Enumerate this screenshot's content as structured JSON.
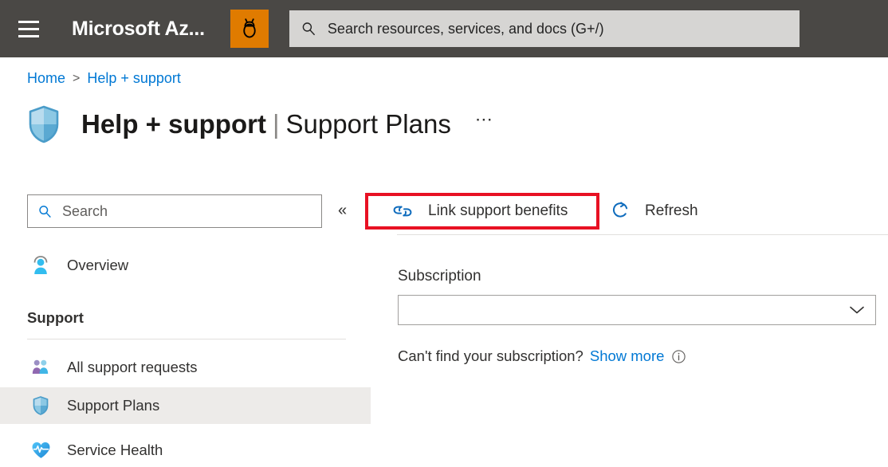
{
  "header": {
    "menu_icon": "hamburger-icon",
    "brand": "Microsoft Az...",
    "bug_icon": "bug-icon",
    "bug_color": "#e07b00",
    "search": {
      "icon": "search-icon",
      "placeholder": "Search resources, services, and docs (G+/)",
      "value": ""
    }
  },
  "breadcrumb": {
    "items": [
      {
        "label": "Home"
      },
      {
        "label": "Help + support"
      }
    ],
    "separator": ">"
  },
  "page": {
    "icon": "shield-icon",
    "title": "Help + support",
    "divider": "|",
    "subtitle": "Support Plans",
    "more_label": "⋯"
  },
  "sidebar": {
    "search": {
      "icon": "search-icon",
      "placeholder": "Search",
      "value": ""
    },
    "collapse_icon": "chevron-double-left-icon",
    "collapse_label": "«",
    "items": [
      {
        "label": "Overview",
        "icon": "support-person-icon",
        "selected": false
      },
      {
        "label": "All support requests",
        "icon": "people-icon",
        "selected": false
      },
      {
        "label": "Support Plans",
        "icon": "shield-icon",
        "selected": true
      },
      {
        "label": "Service Health",
        "icon": "heart-pulse-icon",
        "selected": false
      }
    ],
    "group_title": "Support"
  },
  "toolbar": {
    "link_benefits": {
      "label": "Link support benefits",
      "icon": "link-icon",
      "highlighted": true,
      "highlight_color": "#e81123"
    },
    "refresh": {
      "label": "Refresh",
      "icon": "refresh-icon"
    }
  },
  "main": {
    "subscription_label": "Subscription",
    "subscription_value": "",
    "subscription_chevron_icon": "chevron-down-icon",
    "helper_text": "Can't find your subscription?",
    "helper_link": "Show more",
    "helper_info_icon": "info-icon"
  },
  "colors": {
    "topbar_bg": "#4a4845",
    "accent_blue": "#0078d4",
    "selected_row": "#edebe9",
    "highlight_red": "#e81123",
    "bug_orange": "#e07b00"
  }
}
